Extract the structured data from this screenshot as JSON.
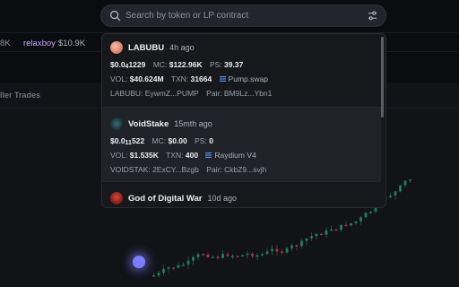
{
  "search": {
    "placeholder": "Search by token or LP contract"
  },
  "background": {
    "ticker_left": "8K",
    "ticker_handle": "relaxboy",
    "ticker_value": "$10.9K",
    "tab_label": "ller Trades"
  },
  "results": [
    {
      "name": "LABUBU",
      "age": "4h ago",
      "price_main": "$0.0",
      "price_sub": "4",
      "price_tail": "1229",
      "mc_label": "MC:",
      "mc_value": "$122.96K",
      "ps_label": "PS:",
      "ps_value": "39.37",
      "vol_label": "VOL:",
      "vol_value": "$40.624M",
      "txn_label": "TXN:",
      "txn_value": "31664",
      "dex": "Pump.swap",
      "token_addr": "LABUBU: EywmZ...PUMP",
      "pair_addr": "Pair: BM9Lz...Ybn1",
      "avatar_color": "#d9826f"
    },
    {
      "name": "VoidStake",
      "age": "15mth ago",
      "price_main": "$0.0",
      "price_sub": "11",
      "price_tail": "522",
      "mc_label": "MC:",
      "mc_value": "$0.00",
      "ps_label": "PS:",
      "ps_value": "0",
      "vol_label": "VOL:",
      "vol_value": "$1.535K",
      "txn_label": "TXN:",
      "txn_value": "400",
      "dex": "Raydium V4",
      "token_addr": "VOIDSTAK: 2ExCY...Bzgb",
      "pair_addr": "Pair: CkbZ9...svjh",
      "avatar_color": "#1d3a40"
    },
    {
      "name": "God of Digital War",
      "age": "10d ago",
      "avatar_color": "#8a1f1f"
    }
  ],
  "colors": {
    "accent_dex": "#5b8def",
    "handle": "#c8a8ff",
    "candle_up": "#2fa37a",
    "candle_down": "#d9485f"
  }
}
